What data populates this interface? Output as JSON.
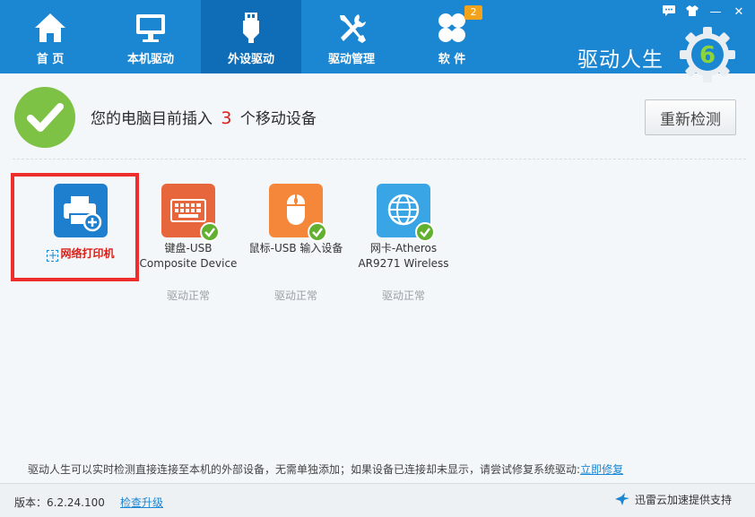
{
  "nav": {
    "items": [
      {
        "label": "首 页",
        "icon": "home-icon"
      },
      {
        "label": "本机驱动",
        "icon": "monitor-icon"
      },
      {
        "label": "外设驱动",
        "icon": "usb-icon",
        "active": true
      },
      {
        "label": "驱动管理",
        "icon": "tools-icon"
      },
      {
        "label": "软 件",
        "icon": "clover-icon"
      }
    ],
    "software_badge": "2"
  },
  "brand": {
    "name": "驱动人生",
    "logo_digit": "6"
  },
  "window_controls": {
    "feedback": "feedback-icon",
    "skin": "shirt-icon",
    "minimize": "—",
    "close": "✕"
  },
  "status": {
    "prefix": "您的电脑目前插入",
    "count": "3",
    "suffix": "个移动设备",
    "recheck_label": "重新检测"
  },
  "devices": [
    {
      "name": "网络打印机",
      "add_symbol": "+",
      "icon": "printer-icon",
      "state": ""
    },
    {
      "name_line1": "键盘-USB",
      "name_line2": "Composite Device",
      "icon": "keyboard-icon",
      "state": "驱动正常"
    },
    {
      "name_line1": "鼠标-USB 输入设备",
      "name_line2": "",
      "icon": "mouse-icon",
      "state": "驱动正常"
    },
    {
      "name_line1": "网卡-Atheros",
      "name_line2": "AR9271 Wireless",
      "icon": "globe-icon",
      "state": "驱动正常"
    }
  ],
  "hint": {
    "text": "驱动人生可以实时检测直接连接至本机的外部设备，无需单独添加；如果设备已连接却未显示，请尝试修复系统驱动:",
    "link": "立即修复"
  },
  "footer": {
    "version": "版本：6.2.24.100",
    "upgrade_link": "检查升级",
    "accel_text": "迅雷云加速提供支持"
  },
  "colors": {
    "header": "#1b86d2",
    "nav_active": "#0f6db7",
    "status_green": "#7dc244",
    "count_red": "#d8201a",
    "highlight_red": "#ee2d2d",
    "printer_blue": "#1f7fcf",
    "keyboard_orange": "#e8663b",
    "mouse_orange": "#f5873b",
    "globe_blue": "#3aa5e4",
    "badge_orange": "#f2a31b"
  }
}
